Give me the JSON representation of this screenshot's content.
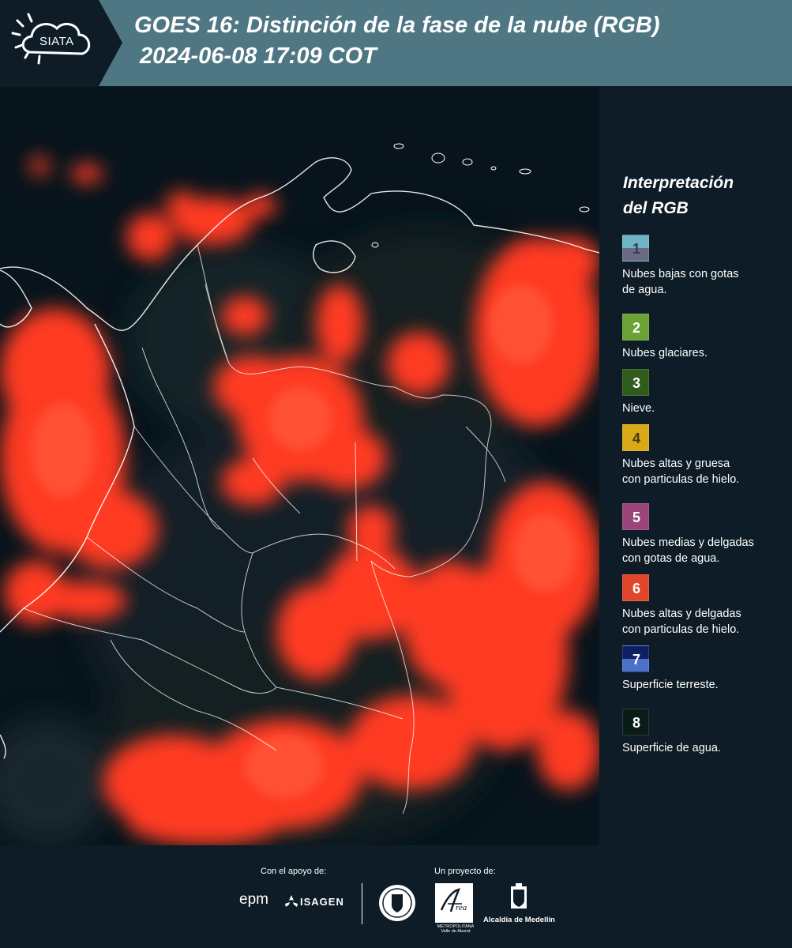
{
  "header": {
    "logo_text": "SIATA",
    "title_line1": "GOES 16: Distinción de la fase de la nube (RGB)",
    "title_line2": "2024-06-08 17:09 COT"
  },
  "legend": {
    "title_line1": "Interpretación",
    "title_line2": "del RGB",
    "items": [
      {
        "num": "1",
        "label_line1": "Nubes bajas con gotas",
        "label_line2": "de agua.",
        "color_top": "#6fb6c4",
        "color_bottom": "#6b6b86",
        "num_color": "#3b3b4c"
      },
      {
        "num": "2",
        "label_line1": "Nubes glaciares.",
        "label_line2": "",
        "color_top": "#6aa235",
        "color_bottom": "#6aa235",
        "num_color": "#ffffff"
      },
      {
        "num": "3",
        "label_line1": "Nieve.",
        "label_line2": "",
        "color_top": "#2f5b1b",
        "color_bottom": "#2f5b1b",
        "num_color": "#ffffff"
      },
      {
        "num": "4",
        "label_line1": "Nubes altas y gruesa",
        "label_line2": "con particulas de hielo.",
        "color_top": "#d9a917",
        "color_bottom": "#d9a917",
        "num_color": "#4a3a0a"
      },
      {
        "num": "5",
        "label_line1": "Nubes medias y delgadas",
        "label_line2": "con gotas de agua.",
        "color_top": "#9b4479",
        "color_bottom": "#9b4479",
        "num_color": "#ffffff"
      },
      {
        "num": "6",
        "label_line1": "Nubes altas y delgadas",
        "label_line2": "con particulas de hielo.",
        "color_top": "#e0472a",
        "color_bottom": "#e0472a",
        "num_color": "#ffffff"
      },
      {
        "num": "7",
        "label_line1": "Superficie terreste.",
        "label_line2": "",
        "color_top": "#0f1f63",
        "color_bottom": "#4a72c8",
        "num_color": "#ffffff"
      },
      {
        "num": "8",
        "label_line1": "Superficie de agua.",
        "label_line2": "",
        "color_top": "#0a1c17",
        "color_bottom": "#0a1c17",
        "num_color": "#ffffff"
      }
    ]
  },
  "footer": {
    "support_caption": "Con el apoyo de:",
    "project_caption": "Un proyecto de:",
    "epm_logo": "epm",
    "isagen_logo": "ISAGEN",
    "area_logo_name": "METROPOLITANA Valle de Aburrá",
    "alcaldia_logo": "Alcaldía de Medellín"
  },
  "colors": {
    "header_bg": "#4e7783",
    "panel_bg": "#0d1c26",
    "ice_cloud": "#ff3a20"
  }
}
